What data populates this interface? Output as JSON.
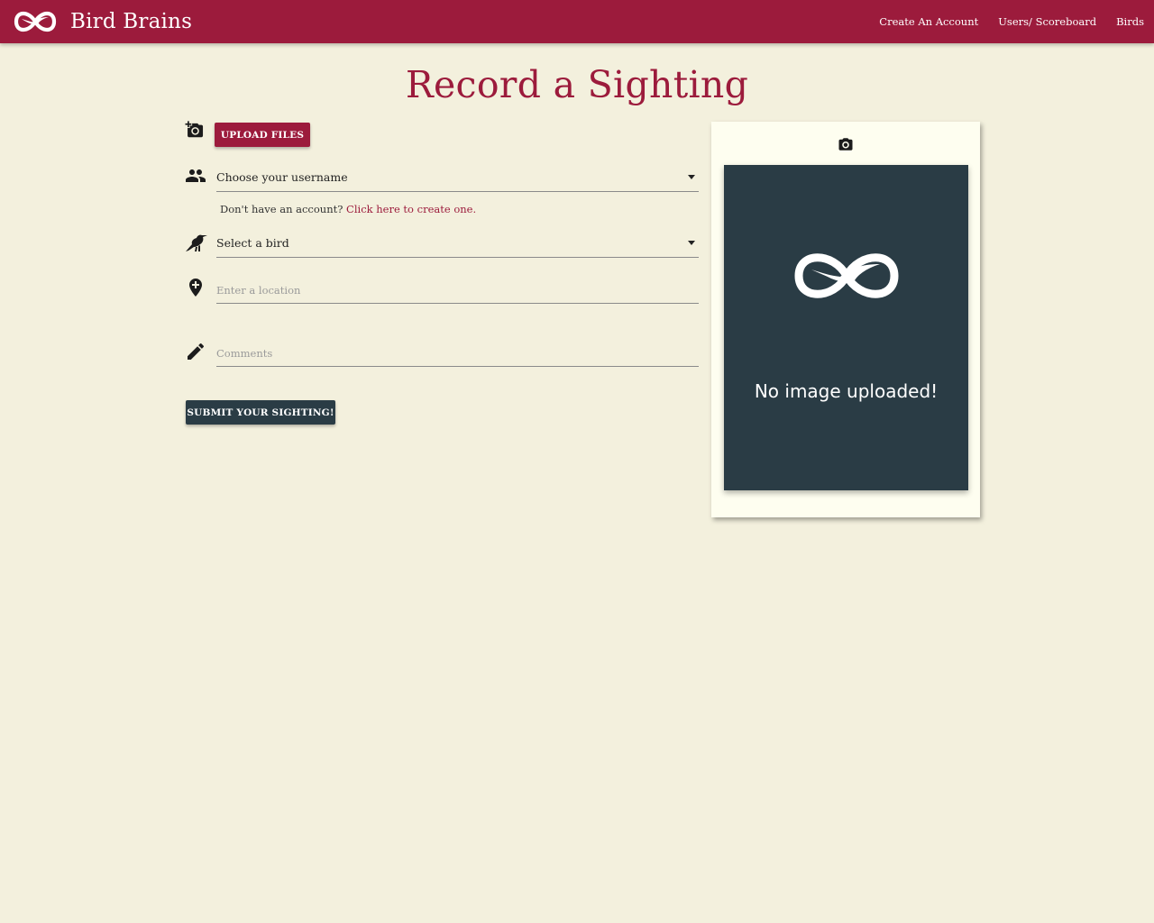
{
  "navbar": {
    "brand": "Bird Brains",
    "links": [
      "Create An Account",
      "Users/ Scoreboard",
      "Birds"
    ]
  },
  "page_title": "Record a Sighting",
  "form": {
    "upload_label": "UPLOAD FILES",
    "username_select": {
      "value": "Choose your username"
    },
    "account_hint": {
      "text": "Don't have an account?",
      "link": "Click here to create one."
    },
    "bird_select": {
      "value": "Select a bird"
    },
    "location": {
      "placeholder": "Enter a location",
      "value": ""
    },
    "comments": {
      "placeholder": "Comments",
      "value": ""
    },
    "submit_label": "SUBMIT YOUR SIGHTING!"
  },
  "preview": {
    "message": "No image uploaded!"
  },
  "icons": {
    "brand": "bird-infinity-logo-icon",
    "upload": "add-a-photo-icon",
    "username": "people-icon",
    "bird": "crow-icon",
    "location": "add-location-icon",
    "comments": "pencil-icon",
    "preview": "camera-icon"
  },
  "colors": {
    "primary": "#9c1b3c",
    "dark": "#2a3c45",
    "background": "#f3f0dd",
    "card": "#fefef0"
  }
}
